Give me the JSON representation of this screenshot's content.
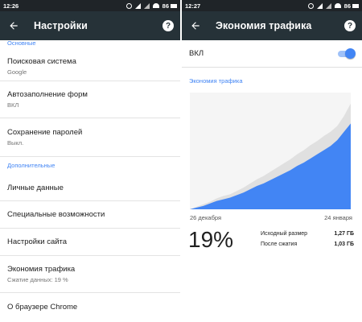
{
  "left": {
    "status": {
      "time": "12:26",
      "battery": "86"
    },
    "toolbar": {
      "title": "Настройки",
      "back_icon": "arrow-left-icon",
      "help_icon": "help-icon"
    },
    "sections": {
      "basic": "Основные",
      "extra": "Дополнительные"
    },
    "items": [
      {
        "label": "Поисковая система",
        "sub": "Google"
      },
      {
        "label": "Автозаполнение форм",
        "sub": "ВКЛ"
      },
      {
        "label": "Сохранение паролей",
        "sub": "Выкл."
      },
      {
        "label": "Личные данные"
      },
      {
        "label": "Специальные возможности"
      },
      {
        "label": "Настройки сайта"
      },
      {
        "label": "Экономия трафика",
        "sub": "Сжатие данных: 19 %"
      },
      {
        "label": "О браузере Chrome"
      }
    ]
  },
  "right": {
    "status": {
      "time": "12:27",
      "battery": "86"
    },
    "toolbar": {
      "title": "Экономия трафика",
      "back_icon": "arrow-left-icon",
      "help_icon": "help-icon"
    },
    "toggle": {
      "label": "ВКЛ",
      "on": true
    },
    "chart_heading": "Экономия трафика",
    "dates": {
      "start": "26 декабря",
      "end": "24 января"
    },
    "percent": "19%",
    "stats": [
      {
        "label": "Исходный размер",
        "value": "1,27 ГБ"
      },
      {
        "label": "После сжатия",
        "value": "1,03 ГБ"
      }
    ]
  },
  "colors": {
    "toolbar": "#263238",
    "accent": "#4285f4",
    "original_area": "#e0e0e0",
    "compressed_area": "#4285f4"
  },
  "chart_data": {
    "type": "area",
    "x": [
      "26 декабря",
      "",
      "",
      "",
      "",
      "",
      "",
      "",
      "",
      "",
      "",
      "",
      "",
      "",
      "",
      "",
      "",
      "",
      "",
      "",
      "",
      "",
      "",
      "",
      "24 января"
    ],
    "series": [
      {
        "values": [
          0.0,
          0.03,
          0.06,
          0.09,
          0.13,
          0.16,
          0.18,
          0.22,
          0.26,
          0.31,
          0.36,
          0.4,
          0.45,
          0.5,
          0.55,
          0.6,
          0.66,
          0.71,
          0.77,
          0.82,
          0.88,
          0.93,
          1.0,
          1.12,
          1.27
        ]
      },
      {
        "values": [
          0.0,
          0.02,
          0.04,
          0.07,
          0.1,
          0.12,
          0.14,
          0.17,
          0.2,
          0.24,
          0.28,
          0.31,
          0.35,
          0.39,
          0.43,
          0.47,
          0.52,
          0.56,
          0.61,
          0.66,
          0.71,
          0.76,
          0.83,
          0.93,
          1.03
        ]
      }
    ],
    "ylim": [
      0,
      1.4
    ],
    "grid": false
  }
}
